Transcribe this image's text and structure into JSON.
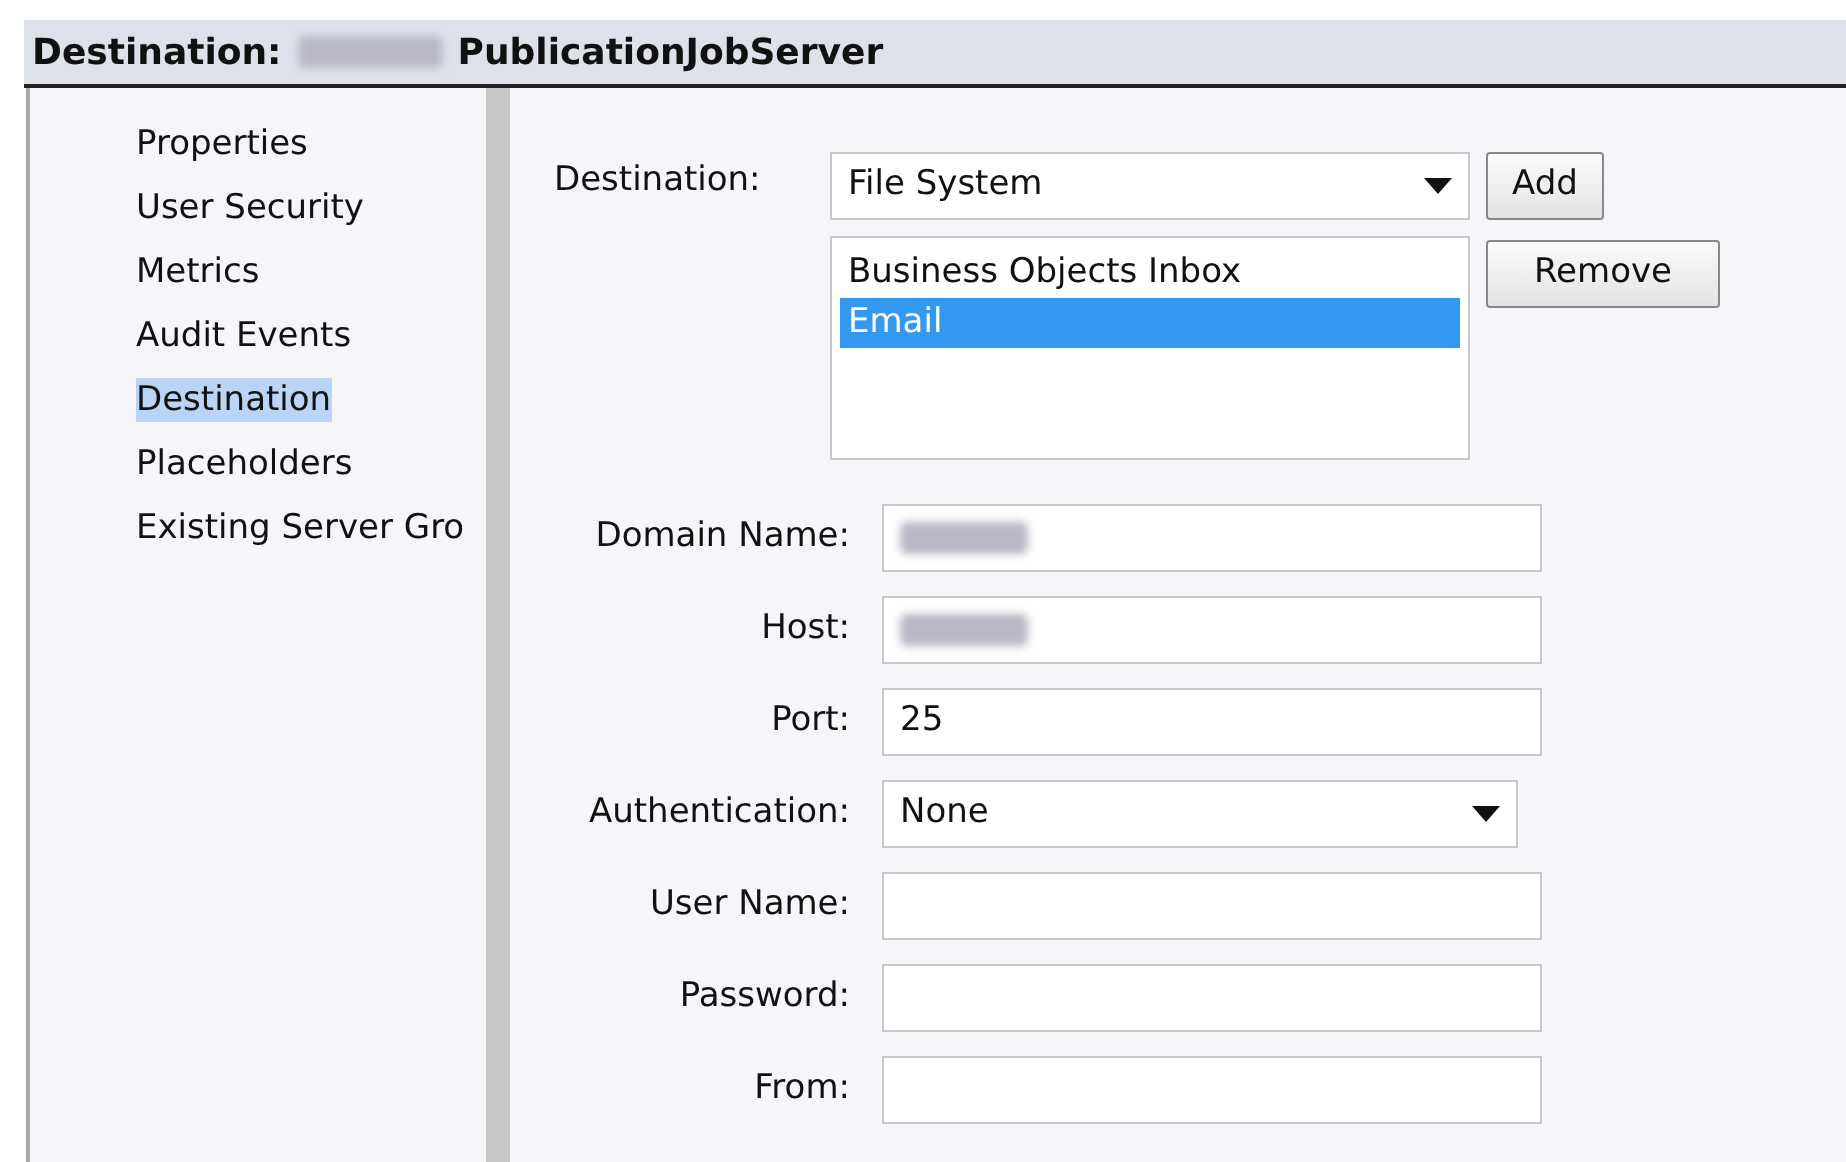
{
  "window": {
    "title_prefix": "Destination:",
    "title_redacted": true,
    "title_suffix": "PublicationJobServer"
  },
  "sidebar": {
    "items": [
      {
        "label": "Properties",
        "selected": false
      },
      {
        "label": "User Security",
        "selected": false
      },
      {
        "label": "Metrics",
        "selected": false
      },
      {
        "label": "Audit Events",
        "selected": false
      },
      {
        "label": "Destination",
        "selected": true
      },
      {
        "label": "Placeholders",
        "selected": false
      },
      {
        "label": "Existing Server Gro",
        "selected": false
      }
    ]
  },
  "destination": {
    "label": "Destination:",
    "value": "File System",
    "add_button": "Add",
    "remove_button": "Remove",
    "list": [
      {
        "label": "Business Objects Inbox",
        "selected": false
      },
      {
        "label": "Email",
        "selected": true
      }
    ]
  },
  "fields": [
    {
      "kind": "text",
      "label": "Domain Name:",
      "redacted": true
    },
    {
      "kind": "text",
      "label": "Host:",
      "redacted": true
    },
    {
      "kind": "text",
      "label": "Port:",
      "value": "25"
    },
    {
      "kind": "select",
      "label": "Authentication:",
      "value": "None"
    },
    {
      "kind": "text",
      "label": "User Name:"
    },
    {
      "kind": "text",
      "label": "Password:"
    },
    {
      "kind": "text",
      "label": "From:"
    }
  ]
}
